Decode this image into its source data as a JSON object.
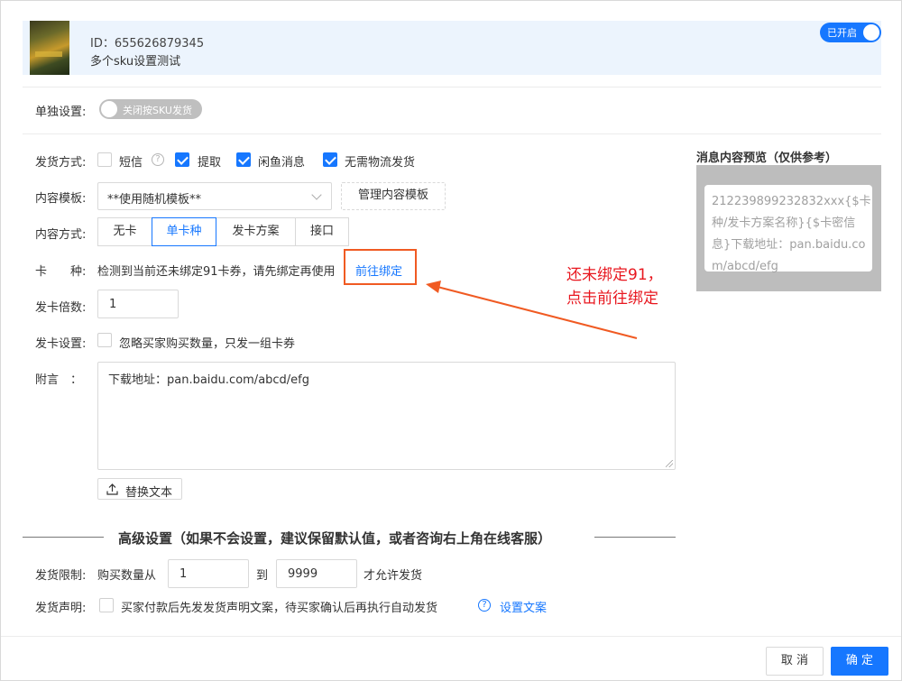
{
  "product": {
    "id_text": "ID：655626879345",
    "name": "多个sku设置测试",
    "thumb_icon": "product-image",
    "enabled_label": "已开启"
  },
  "single_setting": {
    "label": "单独设置:",
    "switch_label": "关闭按SKU发货"
  },
  "shipping": {
    "label": "发货方式:",
    "options": [
      {
        "label": "短信",
        "checked": false
      },
      {
        "label": "提取",
        "checked": true
      },
      {
        "label": "闲鱼消息",
        "checked": true
      },
      {
        "label": "无需物流发货",
        "checked": true
      }
    ]
  },
  "template": {
    "label": "内容模板:",
    "value": "**使用随机模板**",
    "manage_label": "管理内容模板"
  },
  "content_mode": {
    "label": "内容方式:",
    "tabs": [
      "无卡",
      "单卡种",
      "发卡方案",
      "接口"
    ],
    "active_index": 1
  },
  "card_kind": {
    "label": "卡　　种:",
    "message": "检测到当前还未绑定91卡券，请先绑定再使用",
    "link_label": "前往绑定"
  },
  "annotation": {
    "line1": "还未绑定91，",
    "line2": "点击前往绑定"
  },
  "multiplier": {
    "label": "发卡倍数:",
    "value": "1"
  },
  "card_setting": {
    "label": "发卡设置:",
    "option_label": "忽略买家购买数量，只发一组卡券"
  },
  "note": {
    "label": "附言　：",
    "value": "下载地址：pan.baidu.com/abcd/efg",
    "replace_label": "替换文本"
  },
  "advanced": {
    "title": "高级设置（如果不会设置，建议保留默认值，或者咨询右上角在线客服）"
  },
  "limit": {
    "label": "发货限制:",
    "prefix": "购买数量从",
    "from": "1",
    "to_label": "到",
    "to": "9999",
    "suffix": "才允许发货"
  },
  "statement": {
    "label": "发货声明:",
    "text": "买家付款后先发发货声明文案，待买家确认后再执行自动发货",
    "link_label": "设置文案"
  },
  "preview": {
    "title": "消息内容预览（仅供参考）",
    "content": "212239899232832xxx{$卡种/发卡方案名称}{$卡密信息}下载地址：pan.baidu.com/abcd/efg"
  },
  "footer": {
    "cancel_label": "取 消",
    "ok_label": "确 定"
  },
  "colors": {
    "primary": "#1677ff",
    "annotation": "#e8171f",
    "highlight_box": "#f05a22"
  }
}
